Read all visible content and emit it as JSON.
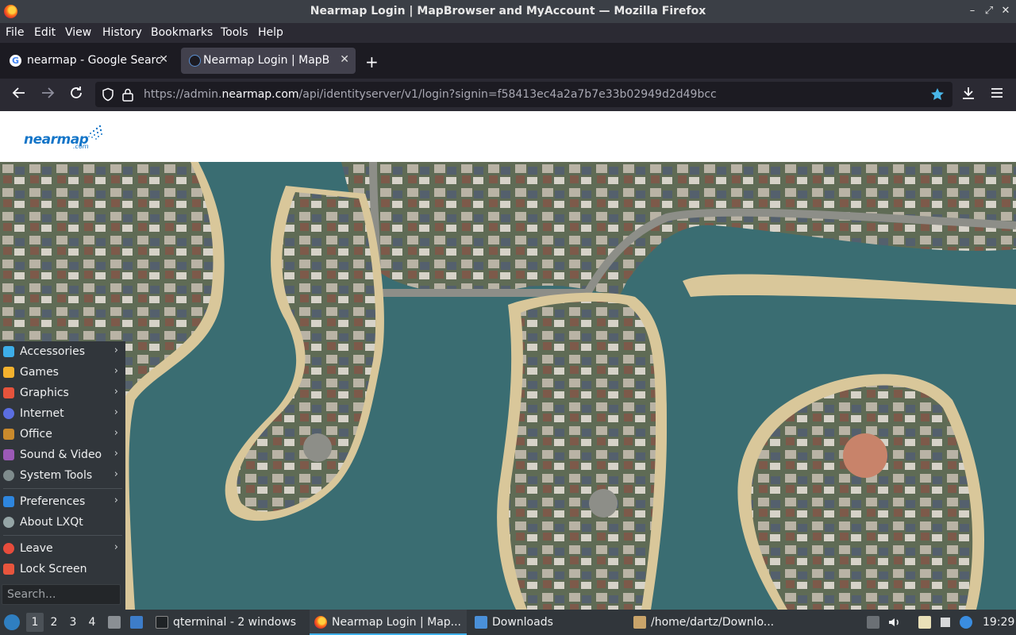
{
  "window": {
    "title": "Nearmap Login | MapBrowser and MyAccount — Mozilla Firefox",
    "controls": {
      "minimize": "–",
      "maximize": "⤢",
      "close": "✕"
    }
  },
  "menubar": [
    "File",
    "Edit",
    "View",
    "History",
    "Bookmarks",
    "Tools",
    "Help"
  ],
  "tabs": [
    {
      "label": "nearmap - Google Search",
      "active": false,
      "favicon": "google-icon"
    },
    {
      "label": "Nearmap Login | MapBrowser and MyAccount",
      "active": true,
      "favicon": "nearmap-icon"
    }
  ],
  "newtab_label": "+",
  "navbar": {
    "url_prefix": "https://admin.",
    "url_domain": "nearmap.com",
    "url_rest": "/api/identityserver/v1/login?signin=f58413ec4a2a7b7e33b02949d2d49bcc",
    "icons": [
      "back-icon",
      "forward-icon",
      "reload-icon",
      "shield-icon",
      "lock-icon",
      "bookmark-star-icon",
      "download-icon",
      "hamburger-menu-icon"
    ]
  },
  "page": {
    "logo_text": "nearmap",
    "logo_suffix": ".com"
  },
  "startmenu": {
    "items": [
      {
        "label": "Accessories",
        "icon": "accessories-icon",
        "color": "#3daee9",
        "submenu": true
      },
      {
        "label": "Games",
        "icon": "games-icon",
        "color": "#f4b22e",
        "submenu": true
      },
      {
        "label": "Graphics",
        "icon": "graphics-icon",
        "color": "#e5533c",
        "submenu": true
      },
      {
        "label": "Internet",
        "icon": "internet-icon",
        "color": "#5b6ee1",
        "submenu": true
      },
      {
        "label": "Office",
        "icon": "office-icon",
        "color": "#c98a2c",
        "submenu": true
      },
      {
        "label": "Sound & Video",
        "icon": "sound-video-icon",
        "color": "#9b59b6",
        "submenu": true
      },
      {
        "label": "System Tools",
        "icon": "system-tools-icon",
        "color": "#7f8c8d",
        "submenu": true
      }
    ],
    "items2": [
      {
        "label": "Preferences",
        "icon": "preferences-icon",
        "color": "#2e86de",
        "submenu": true
      },
      {
        "label": "About LXQt",
        "icon": "info-icon",
        "color": "#95a5a6",
        "submenu": false
      }
    ],
    "items3": [
      {
        "label": "Leave",
        "icon": "power-icon",
        "color": "#e74c3c",
        "submenu": true
      },
      {
        "label": "Lock Screen",
        "icon": "lock-screen-icon",
        "color": "#e8553d",
        "submenu": false
      }
    ],
    "search_placeholder": "Search...",
    "arrow": "›"
  },
  "taskbar": {
    "desktops": [
      "1",
      "2",
      "3",
      "4"
    ],
    "windows": [
      {
        "label": "qterminal - 2 windows",
        "icon": "terminal-icon"
      },
      {
        "label": "Nearmap Login | Map...",
        "icon": "firefox-icon"
      },
      {
        "label": "Downloads",
        "icon": "folder-icon"
      },
      {
        "label": "/home/dartz/Downlo...",
        "icon": "archive-icon"
      }
    ],
    "clock": "19:29"
  }
}
